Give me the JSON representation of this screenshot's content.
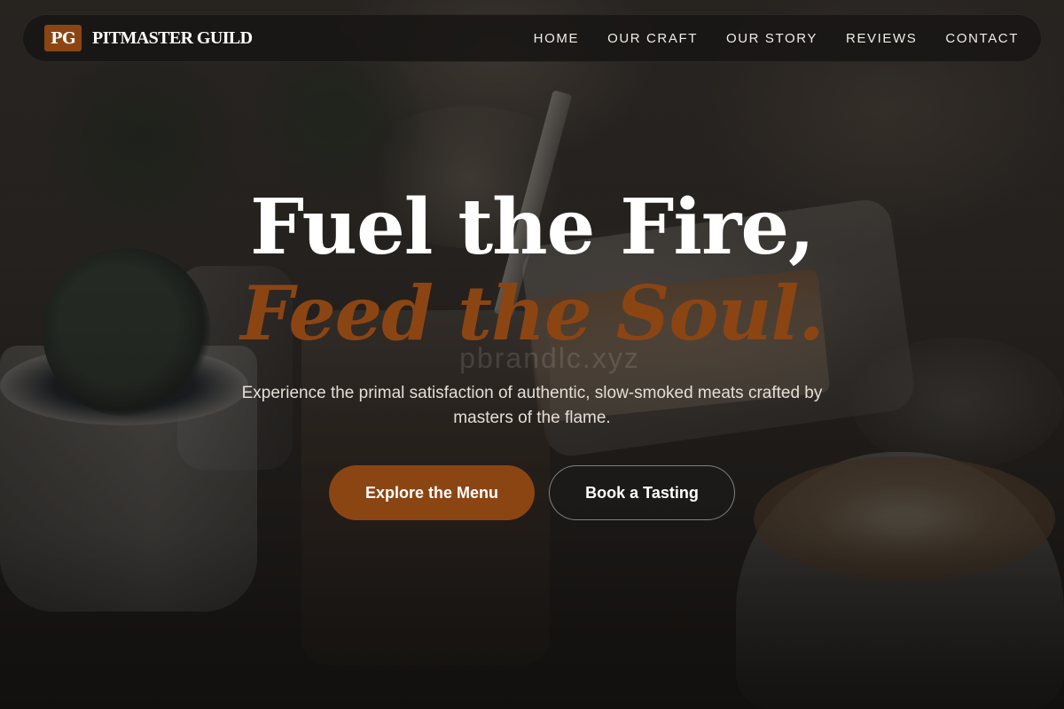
{
  "brand": {
    "logo_initials": "PG",
    "name": "PITMASTER GUILD"
  },
  "nav": {
    "items": [
      {
        "label": "HOME"
      },
      {
        "label": "OUR CRAFT"
      },
      {
        "label": "OUR STORY"
      },
      {
        "label": "REVIEWS"
      },
      {
        "label": "CONTACT"
      }
    ]
  },
  "hero": {
    "headline": "Fuel the Fire,",
    "headline_accent": "Feed the Soul.",
    "watermark": "pbrandlc.xyz",
    "subtitle": "Experience the primal satisfaction of authentic, slow-smoked meats crafted by masters of the flame.",
    "primary_button": "Explore the Menu",
    "secondary_button": "Book a Tasting"
  },
  "colors": {
    "accent": "#8b4513",
    "nav_background": "#181615",
    "text": "#ffffff"
  }
}
